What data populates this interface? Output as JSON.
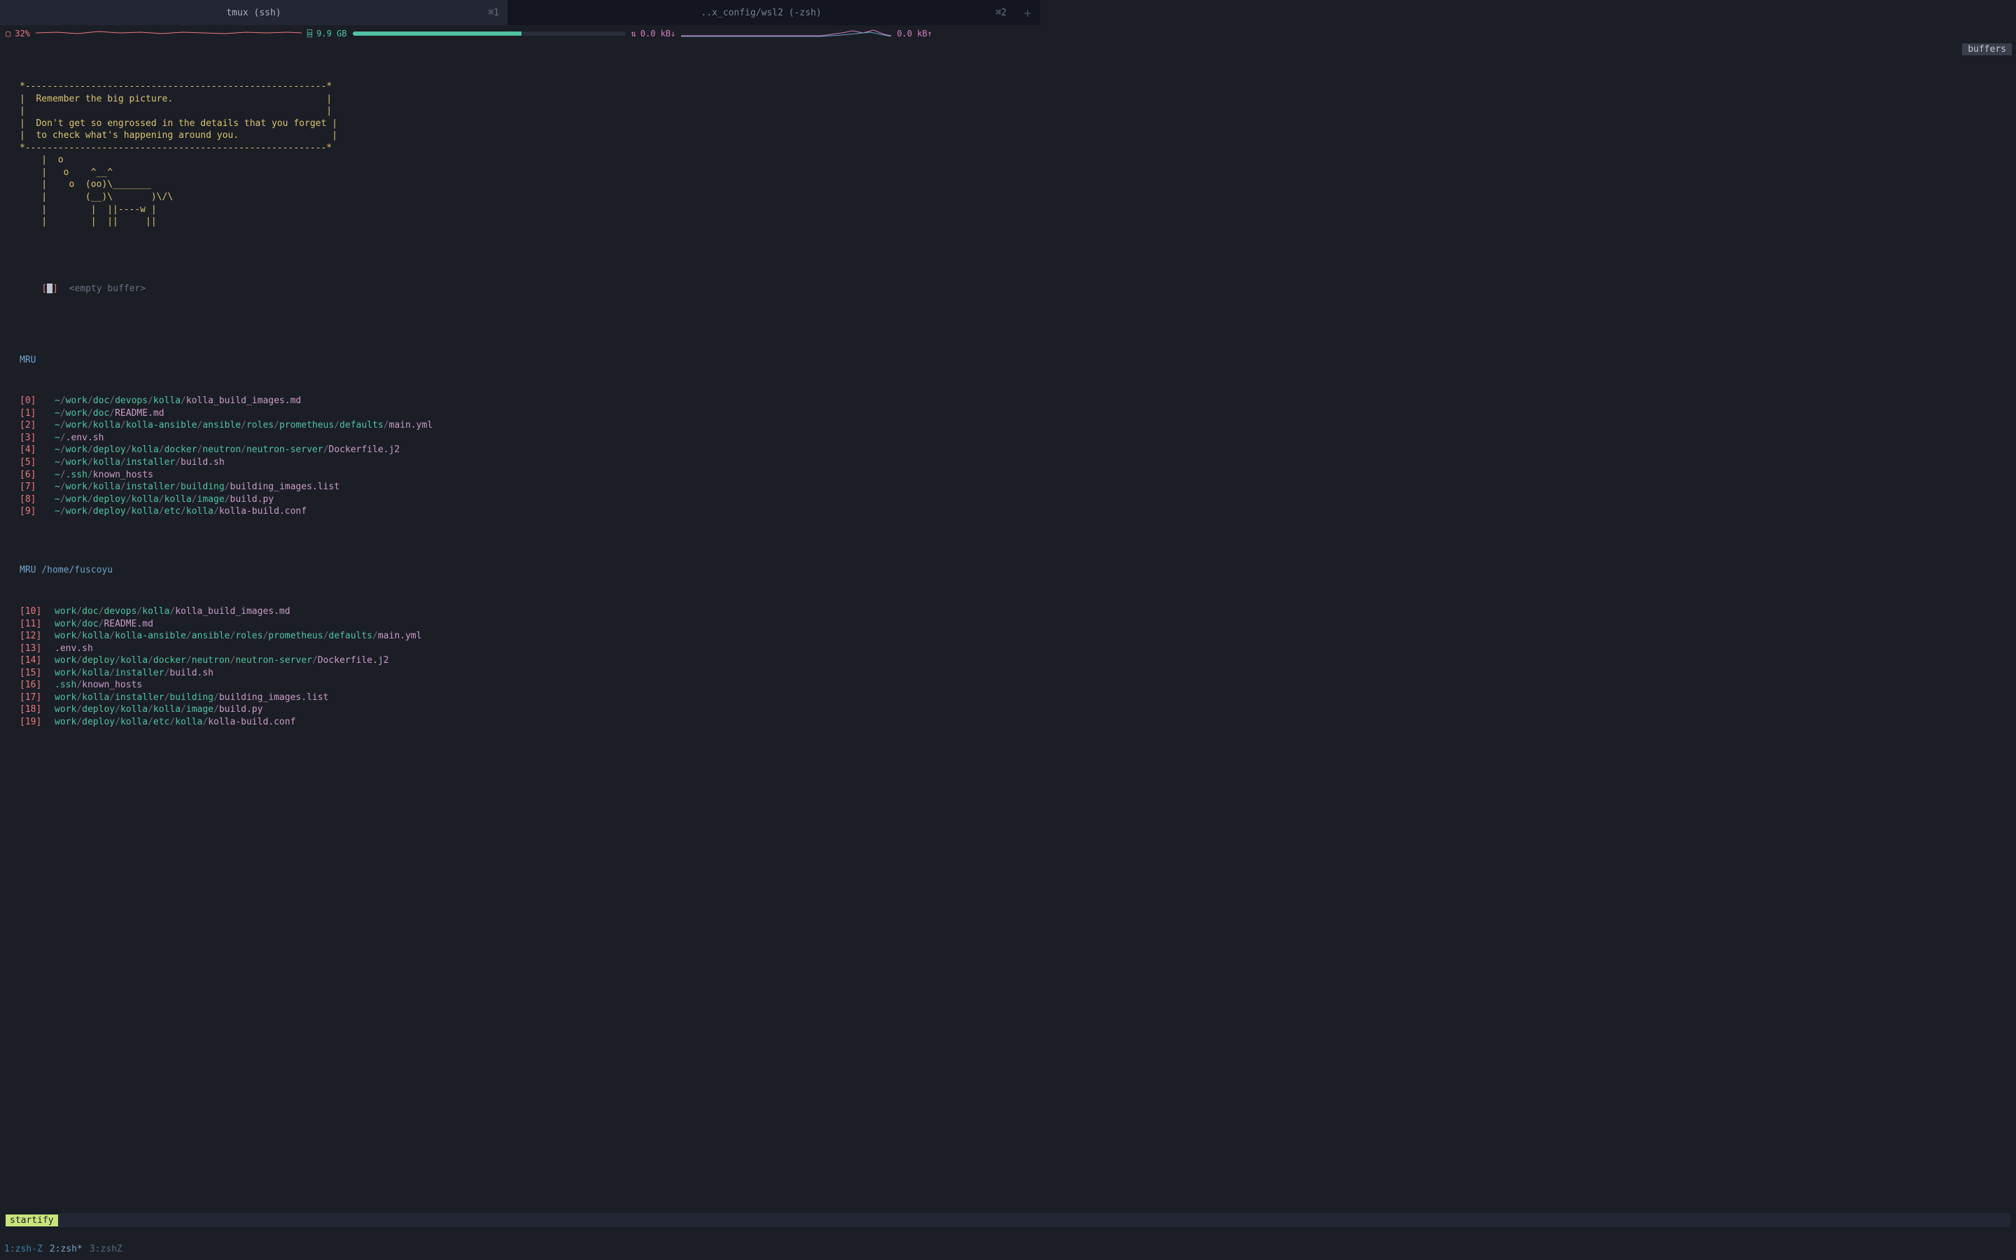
{
  "tabs": [
    {
      "title": "tmux (ssh)",
      "shortcut": "⌘1",
      "active": true
    },
    {
      "title": "..x_config/wsl2 (-zsh)",
      "shortcut": "⌘2",
      "active": false
    }
  ],
  "stats": {
    "cpu": {
      "value": "32%",
      "icon": "▢"
    },
    "mem": {
      "value": "9.9 GB",
      "icon": "⌸",
      "fill_pct": 62
    },
    "net": {
      "down": "0.0 kB↓",
      "up": "0.0 kB↑",
      "icon": "⇅"
    }
  },
  "top_right_label": "buffers",
  "quote": [
    "*-------------------------------------------------------*",
    "|  Remember the big picture.                            |",
    "|                                                       |",
    "|  Don't get so engrossed in the details that you forget |",
    "|  to check what's happening around you.                 |",
    "*-------------------------------------------------------*",
    "    |  o                                                 ",
    "    |   o    ^__^                                        ",
    "    |    o  (oo)\\_______                                ",
    "    |       (__)\\       )\\/\\                           ",
    "    |        |  ||----w |                                ",
    "    |        |  ||     ||                                "
  ],
  "empty_line": {
    "label": "[e]",
    "text": "<empty buffer>"
  },
  "mru": {
    "header": "MRU",
    "items": [
      {
        "idx": "[0]",
        "segments": [
          "~",
          "work",
          "doc",
          "devops",
          "kolla"
        ],
        "file": "kolla_build_images.md"
      },
      {
        "idx": "[1]",
        "segments": [
          "~",
          "work",
          "doc"
        ],
        "file": "README.md"
      },
      {
        "idx": "[2]",
        "segments": [
          "~",
          "work",
          "kolla",
          "kolla-ansible",
          "ansible",
          "roles",
          "prometheus",
          "defaults"
        ],
        "file": "main.yml"
      },
      {
        "idx": "[3]",
        "segments": [
          "~"
        ],
        "file": ".env.sh"
      },
      {
        "idx": "[4]",
        "segments": [
          "~",
          "work",
          "deploy",
          "kolla",
          "docker",
          "neutron",
          "neutron-server"
        ],
        "file": "Dockerfile.j2"
      },
      {
        "idx": "[5]",
        "segments": [
          "~",
          "work",
          "kolla",
          "installer"
        ],
        "file": "build.sh"
      },
      {
        "idx": "[6]",
        "segments": [
          "~",
          ".ssh"
        ],
        "file": "known_hosts"
      },
      {
        "idx": "[7]",
        "segments": [
          "~",
          "work",
          "kolla",
          "installer",
          "building"
        ],
        "file": "building_images.list"
      },
      {
        "idx": "[8]",
        "segments": [
          "~",
          "work",
          "deploy",
          "kolla",
          "kolla",
          "image"
        ],
        "file": "build.py"
      },
      {
        "idx": "[9]",
        "segments": [
          "~",
          "work",
          "deploy",
          "kolla",
          "etc",
          "kolla"
        ],
        "file": "kolla-build.conf"
      }
    ]
  },
  "mru_cwd": {
    "header": "MRU /home/fuscoyu",
    "items": [
      {
        "idx": "[10]",
        "segments": [
          "work",
          "doc",
          "devops",
          "kolla"
        ],
        "file": "kolla_build_images.md"
      },
      {
        "idx": "[11]",
        "segments": [
          "work",
          "doc"
        ],
        "file": "README.md"
      },
      {
        "idx": "[12]",
        "segments": [
          "work",
          "kolla",
          "kolla-ansible",
          "ansible",
          "roles",
          "prometheus",
          "defaults"
        ],
        "file": "main.yml"
      },
      {
        "idx": "[13]",
        "segments": [],
        "file": ".env.sh"
      },
      {
        "idx": "[14]",
        "segments": [
          "work",
          "deploy",
          "kolla",
          "docker",
          "neutron",
          "neutron-server"
        ],
        "file": "Dockerfile.j2"
      },
      {
        "idx": "[15]",
        "segments": [
          "work",
          "kolla",
          "installer"
        ],
        "file": "build.sh"
      },
      {
        "idx": "[16]",
        "segments": [
          ".ssh"
        ],
        "file": "known_hosts"
      },
      {
        "idx": "[17]",
        "segments": [
          "work",
          "kolla",
          "installer",
          "building"
        ],
        "file": "building_images.list"
      },
      {
        "idx": "[18]",
        "segments": [
          "work",
          "deploy",
          "kolla",
          "kolla",
          "image"
        ],
        "file": "build.py"
      },
      {
        "idx": "[19]",
        "segments": [
          "work",
          "deploy",
          "kolla",
          "etc",
          "kolla"
        ],
        "file": "kolla-build.conf"
      }
    ]
  },
  "mode_label": "startify",
  "tmux_windows": [
    {
      "label": "1:zsh-Z",
      "state": "bg"
    },
    {
      "label": "2:zsh*",
      "state": "current"
    },
    {
      "label": "3:zshZ",
      "state": "dim"
    }
  ],
  "colors": {
    "bg": "#1c1e26",
    "accent_yellow": "#d9c370",
    "accent_red": "#e97a7a",
    "accent_teal": "#4fc3a1",
    "accent_blue": "#6ea3c9",
    "accent_pink": "#c89cc8",
    "accent_green_badge": "#c7e57a"
  }
}
